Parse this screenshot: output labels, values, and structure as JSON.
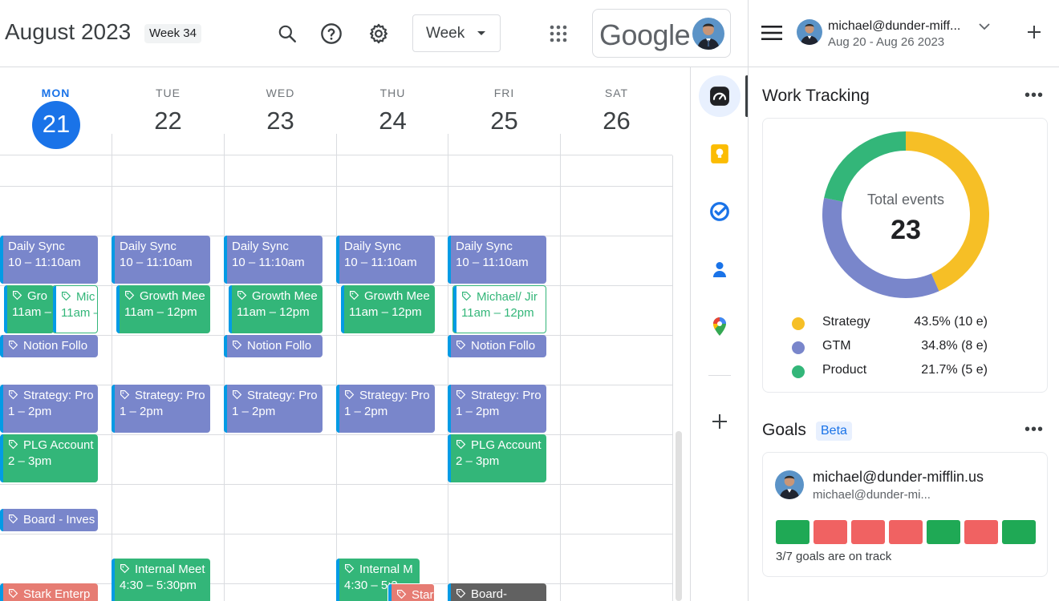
{
  "header": {
    "month_title": "August 2023",
    "week_label": "Week 34",
    "view_label": "Week",
    "brand_text": "Google"
  },
  "days": [
    {
      "name": "MON",
      "date": "21",
      "today": true
    },
    {
      "name": "TUE",
      "date": "22",
      "today": false
    },
    {
      "name": "WED",
      "date": "23",
      "today": false
    },
    {
      "name": "THU",
      "date": "24",
      "today": false
    },
    {
      "name": "FRI",
      "date": "25",
      "today": false
    },
    {
      "name": "SAT",
      "date": "26",
      "today": false
    }
  ],
  "events": {
    "daily_sync": {
      "title": "Daily Sync",
      "time": "10 – 11:10am"
    },
    "growth_meeting": {
      "title": "Growth Mee",
      "time": "11am – 12pm"
    },
    "mon_growth_short": {
      "title": "Gro",
      "time": "11am –"
    },
    "mon_mic_short": {
      "title": "Mic",
      "time": "11am –"
    },
    "michael_jim": {
      "title": "Michael/ Jir",
      "time": "11am – 12pm"
    },
    "notion_follow": {
      "title": "Notion Follo"
    },
    "strategy_pro": {
      "title": "Strategy: Pro",
      "time": "1 – 2pm"
    },
    "plg_account": {
      "title": "PLG Account",
      "time": "2 – 3pm"
    },
    "board_invest": {
      "title": "Board - Inves"
    },
    "internal_meet_tue": {
      "title": "Internal Meet",
      "time": "4:30 – 5:30pm"
    },
    "internal_meet_thu": {
      "title": "Internal M",
      "time": "4:30 – 5:3"
    },
    "stark_mon": {
      "title": "Stark Enterp"
    },
    "stark_thu": {
      "title": "Star"
    },
    "board_fri": {
      "title": "Board-"
    }
  },
  "panel": {
    "account_email": "michael@dunder-miff...",
    "date_range": "Aug 20 - Aug 26 2023",
    "work_tracking_title": "Work Tracking",
    "total_label": "Total events",
    "total_value": "23",
    "goals_title": "Goals",
    "beta_label": "Beta",
    "goal_user_name": "michael@dunder-mifflin.us",
    "goal_user_sub": "michael@dunder-mi...",
    "goals_status": "3/7 goals are on track",
    "goal_squares": [
      "on-track",
      "off-track",
      "off-track",
      "off-track",
      "on-track",
      "off-track",
      "on-track"
    ]
  },
  "chart_data": {
    "type": "pie",
    "title": "Total events",
    "total": 23,
    "categories": [
      "Strategy",
      "GTM",
      "Product"
    ],
    "values": [
      10,
      8,
      5
    ],
    "value_labels": [
      "43.5% (10 e)",
      "34.8% (8 e)",
      "21.7% (5 e)"
    ],
    "colors": [
      "#f6bf26",
      "#7986cb",
      "#33b679"
    ]
  },
  "colors": {
    "accent": "#1a73e8",
    "gtm": "#7986cb",
    "product": "#33b679",
    "strategy": "#f6bf26",
    "off_track": "#f06262",
    "on_track": "#1fa955"
  },
  "icons": {
    "search": "search-icon",
    "help": "help-icon",
    "settings": "gear-icon",
    "apps": "apps-grid-icon",
    "menu": "menu-icon",
    "add": "plus-icon",
    "tag": "tag-icon"
  }
}
